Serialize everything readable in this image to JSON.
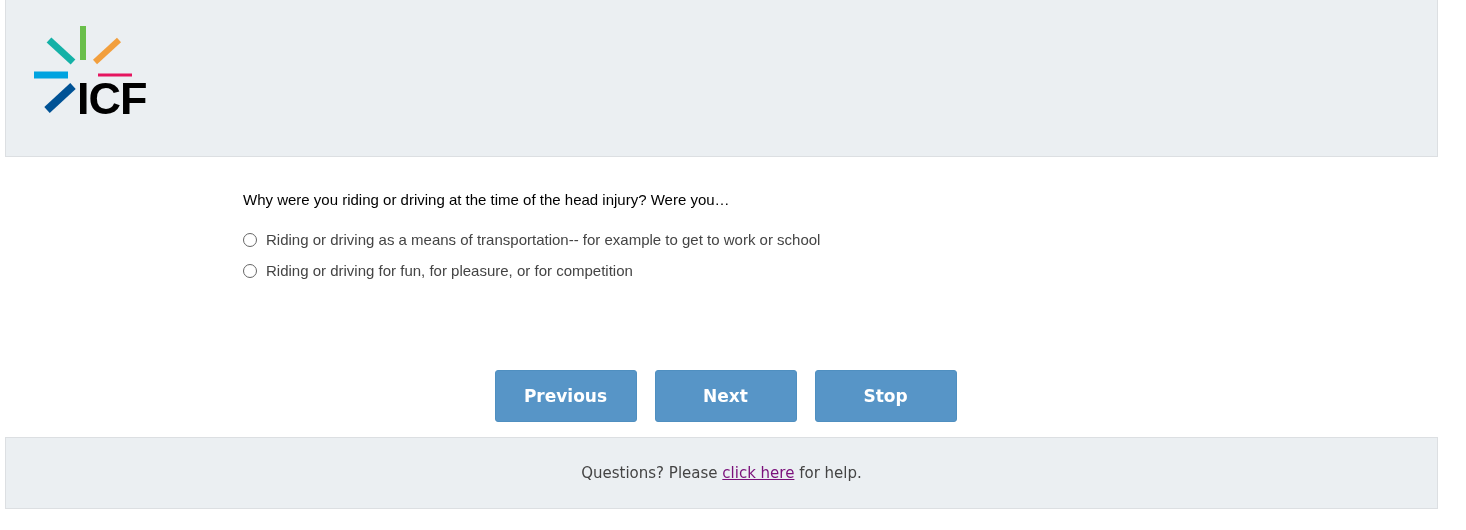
{
  "header": {
    "logo_text": "ICF"
  },
  "question": {
    "text": "Why were you riding or driving at the time of the head injury? Were you…",
    "options": [
      {
        "label": "Riding or driving as a means of transportation-- for example to get to work or school",
        "selected": false
      },
      {
        "label": "Riding or driving for fun, for pleasure, or for competition",
        "selected": false
      }
    ]
  },
  "buttons": [
    "Previous",
    "Next",
    "Stop"
  ],
  "footer": {
    "before": "Questions? Please ",
    "link": "click here",
    "after": " for help."
  }
}
